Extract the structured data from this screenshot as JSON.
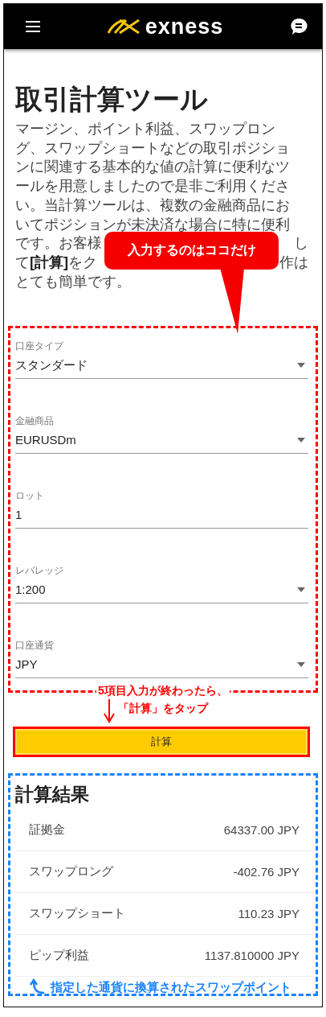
{
  "header": {
    "logo_text": "exness"
  },
  "title": "取引計算ツール",
  "description_lines": [
    {
      "segments": [
        "マージン、ポイント利益、スワップロン"
      ]
    },
    {
      "segments": [
        "グ、スワップショートなどの取引ポジショ"
      ]
    },
    {
      "segments": [
        "ンに関連する基本的な値の計算に便利なツ"
      ]
    },
    {
      "segments": [
        "ールを用意しましたので是非ご利用くださ"
      ]
    },
    {
      "segments": [
        "い。当計算ツールは、複数の金融商品にお"
      ]
    },
    {
      "segments": [
        "いてポジションが未決済な場合に特に便利"
      ]
    },
    {
      "segments": [
        "です。お客様",
        "し"
      ]
    },
    {
      "segments": [
        "て**[計算]**をク",
        "作は"
      ]
    },
    {
      "segments": [
        "とても簡単です。"
      ]
    }
  ],
  "callout": "入力するのはココだけ",
  "form": {
    "fields": [
      {
        "kind": "select",
        "label": "口座タイプ",
        "value": "スタンダード"
      },
      {
        "kind": "select",
        "label": "金融商品",
        "value": "EURUSDm"
      },
      {
        "kind": "input",
        "label": "ロット",
        "value": "1"
      },
      {
        "kind": "select",
        "label": "レバレッジ",
        "value": "1:200"
      },
      {
        "kind": "select",
        "label": "口座通貨",
        "value": "JPY"
      }
    ]
  },
  "step_note": [
    "5項目入力が終わったら、",
    "「計算」をタップ"
  ],
  "calculate_button": "計算",
  "results": {
    "title": "計算結果",
    "rows": [
      {
        "label": "証拠金",
        "value": "64337.00 JPY"
      },
      {
        "label": "スワップロング",
        "value": "-402.76 JPY"
      },
      {
        "label": "スワップショート",
        "value": "110.23 JPY"
      },
      {
        "label": "ピップ利益",
        "value": "1137.810000 JPY"
      }
    ]
  },
  "result_note": "指定した通貨に換算されたスワップポイント"
}
